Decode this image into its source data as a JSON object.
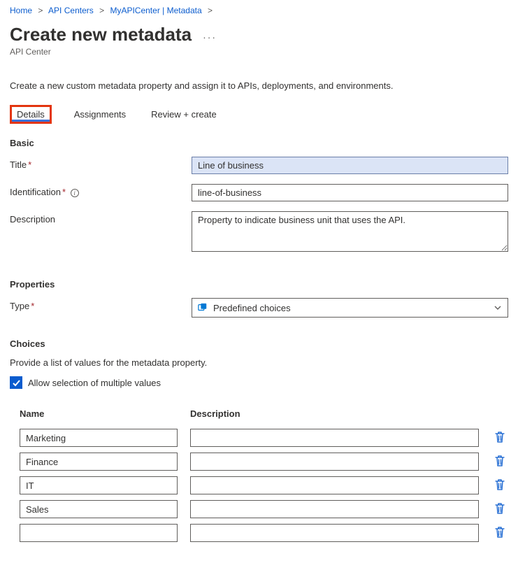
{
  "breadcrumb": {
    "home": "Home",
    "centers": "API Centers",
    "current": "MyAPICenter | Metadata"
  },
  "header": {
    "title": "Create new metadata",
    "subtitle": "API Center"
  },
  "intro": "Create a new custom metadata property and assign it to APIs, deployments, and environments.",
  "tabs": {
    "details": "Details",
    "assignments": "Assignments",
    "review": "Review + create"
  },
  "basic": {
    "section": "Basic",
    "title_label": "Title",
    "title_value": "Line of business",
    "identification_label": "Identification",
    "identification_value": "line-of-business",
    "description_label": "Description",
    "description_value": "Property to indicate business unit that uses the API."
  },
  "properties": {
    "section": "Properties",
    "type_label": "Type",
    "type_value": "Predefined choices"
  },
  "choices": {
    "section": "Choices",
    "desc": "Provide a list of values for the metadata property.",
    "allow_multi": "Allow selection of multiple values",
    "col_name": "Name",
    "col_desc": "Description",
    "rows": [
      {
        "name": "Marketing",
        "desc": ""
      },
      {
        "name": "Finance",
        "desc": ""
      },
      {
        "name": "IT",
        "desc": ""
      },
      {
        "name": "Sales",
        "desc": ""
      },
      {
        "name": "",
        "desc": ""
      }
    ]
  }
}
